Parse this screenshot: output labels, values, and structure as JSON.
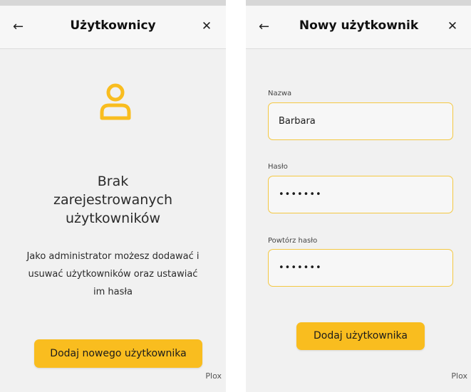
{
  "left_screen": {
    "header": {
      "title": "Użytkownicy",
      "back_icon": "arrow-left-icon",
      "close_icon": "close-icon"
    },
    "empty_state": {
      "icon": "user-outline-icon",
      "icon_color": "#f9bd1f",
      "title_lines": [
        "Brak",
        "zarejestrowanych",
        "użytkowników"
      ],
      "description": "Jako administrator możesz dodawać i usuwać użytkowników oraz ustawiać im hasła"
    },
    "primary_button_label": "Dodaj nowego użytkownika",
    "brand": "Plox"
  },
  "right_screen": {
    "header": {
      "title": "Nowy użytkownik",
      "back_icon": "arrow-left-icon",
      "close_icon": "close-icon"
    },
    "fields": [
      {
        "label": "Nazwa",
        "value": "Barbara"
      },
      {
        "label": "Hasło",
        "value": "•••••••"
      },
      {
        "label": "Powtórz hasło",
        "value": "•••••••"
      }
    ],
    "submit_button_label": "Dodaj użytkownika",
    "brand": "Plox"
  },
  "theme": {
    "accent": "#f9bd1f",
    "background": "#f1f1f1",
    "header_bg": "#f7f7f7"
  }
}
